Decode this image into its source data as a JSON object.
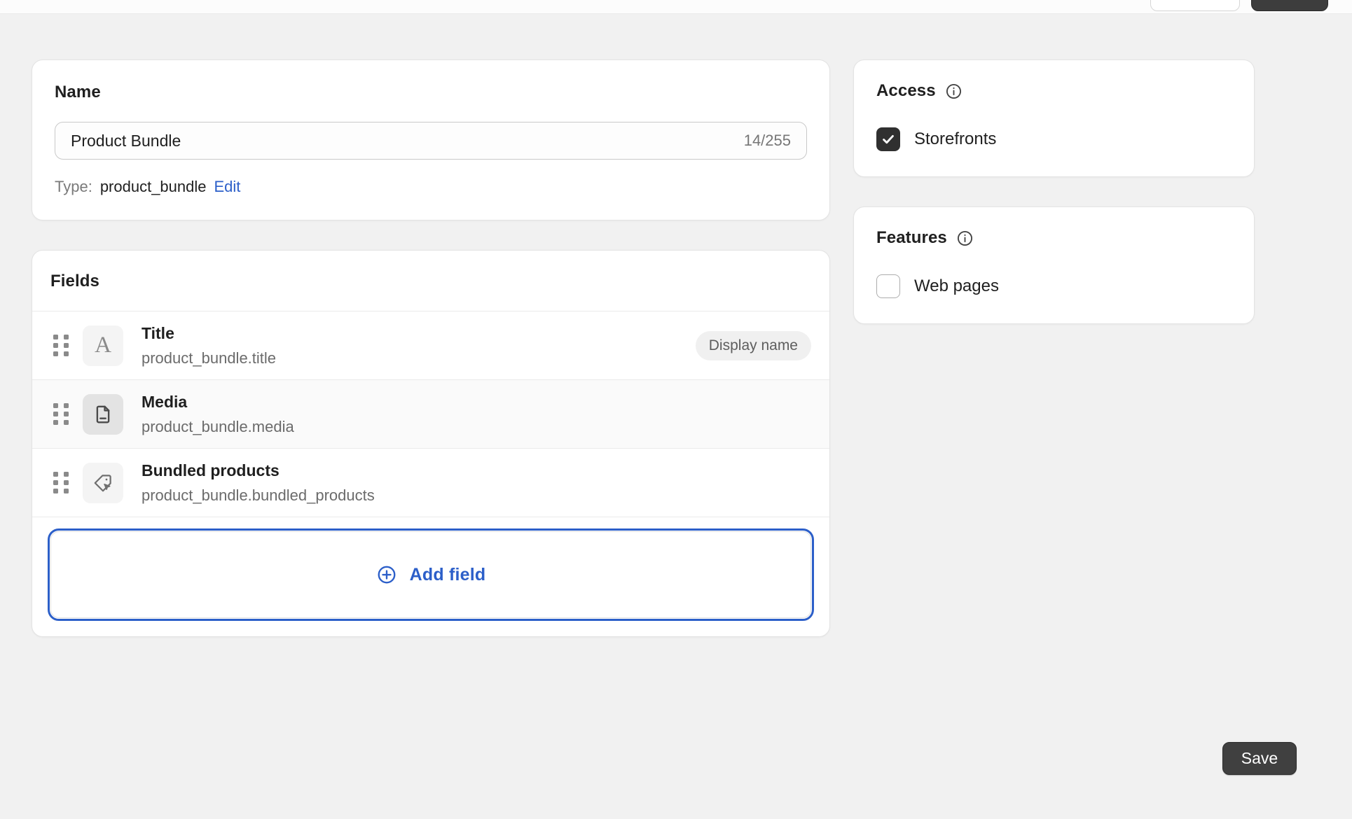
{
  "topbar": {
    "secondary_button_label": "",
    "primary_button_label": ""
  },
  "name_card": {
    "title": "Name",
    "input": {
      "value": "Product Bundle",
      "placeholder": "Name",
      "counter": "14/255"
    },
    "type_label": "Type:",
    "type_value": "product_bundle",
    "edit_link": "Edit"
  },
  "fields_card": {
    "title": "Fields",
    "rows": [
      {
        "name": "Title",
        "key": "product_bundle.title",
        "icon": "text-a-icon",
        "badge": "Display name",
        "hovered": false
      },
      {
        "name": "Media",
        "key": "product_bundle.media",
        "icon": "document-icon",
        "badge": "",
        "hovered": true
      },
      {
        "name": "Bundled products",
        "key": "product_bundle.bundled_products",
        "icon": "product-tag-cursor-icon",
        "badge": "",
        "hovered": false
      }
    ],
    "add_field_label": "Add field",
    "add_field_icon": "plus-circle-icon"
  },
  "access_card": {
    "title": "Access",
    "info_icon": "info-icon",
    "options": [
      {
        "label": "Storefronts",
        "checked": true
      }
    ]
  },
  "features_card": {
    "title": "Features",
    "info_icon": "info-icon",
    "options": [
      {
        "label": "Web pages",
        "checked": false
      }
    ]
  },
  "footer": {
    "save_label": "Save"
  },
  "colors": {
    "accent_blue": "#2c5fc9",
    "page_background": "#f1f1f1",
    "card_background": "#ffffff",
    "dark_button": "#404040",
    "checked_checkbox": "#303030",
    "row_hover": "#fafafa"
  }
}
